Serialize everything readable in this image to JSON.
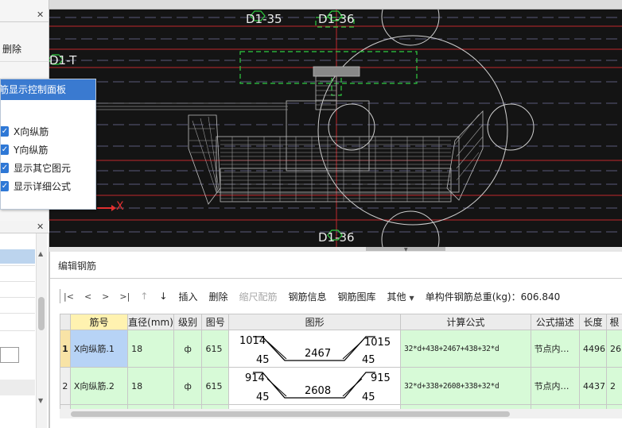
{
  "left_panel": {
    "close_icon": "close-icon",
    "delete_label": "删除"
  },
  "control_panel": {
    "title": "筋显示控制面板",
    "options": [
      {
        "label": "X向纵筋",
        "checked": true
      },
      {
        "label": "Y向纵筋",
        "checked": true
      },
      {
        "label": "显示其它图元",
        "checked": true
      },
      {
        "label": "显示详细公式",
        "checked": true
      }
    ]
  },
  "canvas": {
    "labels": {
      "d1_35": "D1-35",
      "d1_36_top": "D1-36",
      "d1_t": "D1-T",
      "d1_36_bottom": "D1-36",
      "axis_x": "X"
    },
    "colors": {
      "background": "#141414",
      "grid_red": "#c0272d",
      "axis_green": "#2ecc40",
      "rebar_white": "#d8d8d8"
    }
  },
  "edit_panel": {
    "title": "编辑钢筋",
    "toolbar": {
      "nav_first": "|<",
      "nav_prev": "<",
      "nav_next": ">",
      "nav_last": ">|",
      "move_up": "↑",
      "move_down": "↓",
      "insert": "插入",
      "delete": "删除",
      "scale_rebar": "缩尺配筋",
      "rebar_info": "钢筋信息",
      "rebar_library": "钢筋图库",
      "other": "其他",
      "total_weight": "单构件钢筋总重(kg)：606.840"
    },
    "columns": [
      "筋号",
      "直径(mm)",
      "级别",
      "图号",
      "图形",
      "计算公式",
      "公式描述",
      "长度",
      "根"
    ],
    "rows": [
      {
        "index": "1",
        "name": "X向纵筋.1",
        "diameter": "18",
        "grade": "ф",
        "fig_no": "615",
        "shape": {
          "left_top": "1014",
          "right_top": "1015",
          "left_bottom": "45",
          "right_bottom": "45",
          "middle": "2467"
        },
        "formula": "32*d+438+2467+438+32*d",
        "description": "节点内…",
        "length": "4496",
        "count": "26"
      },
      {
        "index": "2",
        "name": "X向纵筋.2",
        "diameter": "18",
        "grade": "ф",
        "fig_no": "615",
        "shape": {
          "left_top": "914",
          "right_top": "915",
          "left_bottom": "45",
          "right_bottom": "45",
          "middle": "2608"
        },
        "formula": "32*d+338+2608+338+32*d",
        "description": "节点内…",
        "length": "4437",
        "count": "2"
      }
    ]
  }
}
